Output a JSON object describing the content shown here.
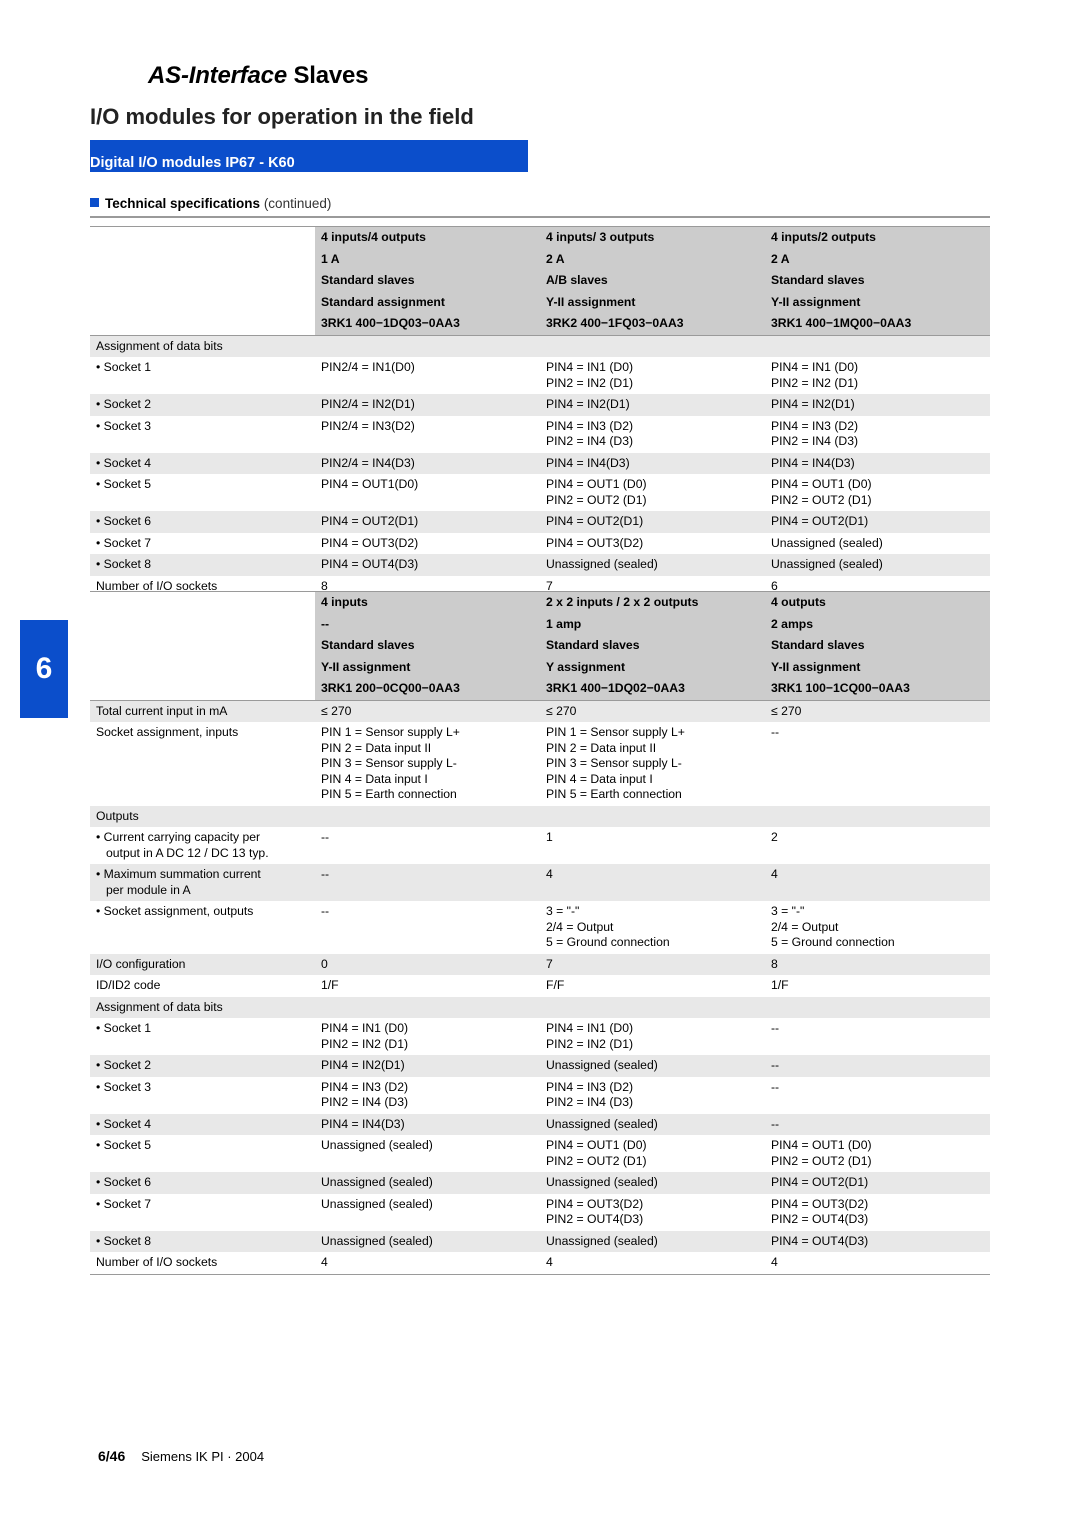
{
  "header": {
    "title_part1": "AS-Interface",
    "title_part2": " Slaves",
    "subtitle": "I/O modules for operation in the field",
    "blue_bar": "Digital I/O modules IP67 - K60",
    "section_title": "Technical specifications",
    "section_suffix": " (continued)",
    "chapter_number": "6",
    "accent_color": "#0b4ecb"
  },
  "footer": {
    "page": "6/46",
    "source": "Siemens IK PI · 2004"
  },
  "table1": {
    "header_rows": [
      [
        "",
        "4 inputs/4 outputs",
        "4 inputs/ 3 outputs",
        "4 inputs/2 outputs"
      ],
      [
        "",
        "1 A",
        "2 A",
        "2 A"
      ],
      [
        "",
        "Standard slaves",
        "A/B slaves",
        "Standard slaves"
      ],
      [
        "",
        "Standard assignment",
        "Y-II assignment",
        "Y-II assignment"
      ],
      [
        "",
        "3RK1 400−1DQ03−0AA3",
        "3RK2 400−1FQ03−0AA3",
        "3RK1 400−1MQ00−0AA3"
      ]
    ],
    "rows": [
      {
        "label": "Assignment of data bits",
        "bullet": false,
        "cells": [
          "",
          "",
          ""
        ]
      },
      {
        "label": "Socket 1",
        "bullet": true,
        "cells": [
          "PIN2/4 = IN1(D0)",
          "PIN4 = IN1 (D0)\nPIN2 = IN2 (D1)",
          "PIN4 = IN1 (D0)\nPIN2 = IN2 (D1)"
        ]
      },
      {
        "label": "Socket 2",
        "bullet": true,
        "cells": [
          "PIN2/4 = IN2(D1)",
          "PIN4 = IN2(D1)",
          "PIN4 = IN2(D1)"
        ]
      },
      {
        "label": "Socket 3",
        "bullet": true,
        "cells": [
          "PIN2/4 = IN3(D2)",
          "PIN4 = IN3 (D2)\nPIN2 = IN4 (D3)",
          "PIN4 = IN3 (D2)\nPIN2 = IN4 (D3)"
        ]
      },
      {
        "label": "Socket 4",
        "bullet": true,
        "cells": [
          "PIN2/4 = IN4(D3)",
          "PIN4 = IN4(D3)",
          "PIN4 = IN4(D3)"
        ]
      },
      {
        "label": "Socket 5",
        "bullet": true,
        "cells": [
          "PIN4 = OUT1(D0)",
          "PIN4 = OUT1 (D0)\nPIN2 = OUT2 (D1)",
          "PIN4 = OUT1 (D0)\nPIN2 = OUT2 (D1)"
        ]
      },
      {
        "label": "Socket 6",
        "bullet": true,
        "cells": [
          "PIN4 = OUT2(D1)",
          "PIN4 = OUT2(D1)",
          "PIN4 = OUT2(D1)"
        ]
      },
      {
        "label": "Socket 7",
        "bullet": true,
        "cells": [
          "PIN4 = OUT3(D2)",
          "PIN4 = OUT3(D2)",
          "Unassigned (sealed)"
        ]
      },
      {
        "label": "Socket 8",
        "bullet": true,
        "cells": [
          "PIN4 = OUT4(D3)",
          "Unassigned (sealed)",
          "Unassigned (sealed)"
        ]
      },
      {
        "label": "Number of I/O sockets",
        "bullet": false,
        "cells": [
          "8",
          "7",
          "6"
        ]
      }
    ]
  },
  "table2": {
    "header_rows": [
      [
        "",
        "4 inputs",
        "2 x 2 inputs / 2 x 2 outputs",
        "4 outputs"
      ],
      [
        "",
        "--",
        "1 amp",
        "2 amps"
      ],
      [
        "",
        "Standard slaves",
        "Standard slaves",
        "Standard slaves"
      ],
      [
        "",
        "Y-II assignment",
        "Y assignment",
        "Y-II assignment"
      ],
      [
        "",
        "3RK1 200−0CQ00−0AA3",
        "3RK1 400−1DQ02−0AA3",
        "3RK1 100−1CQ00−0AA3"
      ]
    ],
    "rows": [
      {
        "label": "Total current input in mA",
        "bullet": false,
        "cells": [
          "≤ 270",
          "≤ 270",
          "≤ 270"
        ]
      },
      {
        "label": "Socket assignment, inputs",
        "bullet": false,
        "cells": [
          "PIN 1 = Sensor supply L+\nPIN 2 = Data input II\nPIN 3 = Sensor supply L-\nPIN 4 = Data input I\nPIN 5 = Earth connection",
          "PIN 1 = Sensor supply L+\nPIN 2 = Data input II\nPIN 3 = Sensor supply L-\nPIN 4 = Data input I\nPIN 5 = Earth connection",
          "--"
        ]
      },
      {
        "label": "Outputs",
        "bullet": false,
        "cells": [
          "",
          "",
          ""
        ]
      },
      {
        "label": "Current carrying capacity per\noutput in A DC 12 / DC 13 typ.",
        "bullet": true,
        "cells": [
          "--",
          "1",
          "2"
        ]
      },
      {
        "label": "Maximum summation current\nper module in A",
        "bullet": true,
        "cells": [
          "--",
          "4",
          "4"
        ]
      },
      {
        "label": "Socket assignment, outputs",
        "bullet": true,
        "cells": [
          "--",
          "3 = \"-\"\n2/4 = Output\n5 = Ground connection",
          "3 = \"-\"\n2/4 = Output\n5 = Ground connection"
        ]
      },
      {
        "label": "I/O configuration",
        "bullet": false,
        "cells": [
          "0",
          "7",
          "8"
        ]
      },
      {
        "label": "ID/ID2 code",
        "bullet": false,
        "cells": [
          "1/F",
          "F/F",
          "1/F"
        ]
      },
      {
        "label": "Assignment of data bits",
        "bullet": false,
        "cells": [
          "",
          "",
          ""
        ]
      },
      {
        "label": "Socket 1",
        "bullet": true,
        "cells": [
          "PIN4 = IN1 (D0)\nPIN2 = IN2 (D1)",
          "PIN4 = IN1 (D0)\nPIN2 = IN2 (D1)",
          "--"
        ]
      },
      {
        "label": "Socket 2",
        "bullet": true,
        "cells": [
          "PIN4 = IN2(D1)",
          "Unassigned (sealed)",
          "--"
        ]
      },
      {
        "label": "Socket 3",
        "bullet": true,
        "cells": [
          "PIN4 = IN3 (D2)\nPIN2 = IN4 (D3)",
          "PIN4 = IN3 (D2)\nPIN2 = IN4 (D3)",
          "--"
        ]
      },
      {
        "label": "Socket 4",
        "bullet": true,
        "cells": [
          "PIN4 = IN4(D3)",
          "Unassigned (sealed)",
          "--"
        ]
      },
      {
        "label": "Socket 5",
        "bullet": true,
        "cells": [
          "Unassigned (sealed)",
          "PIN4 = OUT1 (D0)\nPIN2 = OUT2 (D1)",
          "PIN4 = OUT1 (D0)\nPIN2 = OUT2 (D1)"
        ]
      },
      {
        "label": "Socket 6",
        "bullet": true,
        "cells": [
          "Unassigned (sealed)",
          "Unassigned (sealed)",
          "PIN4 = OUT2(D1)"
        ]
      },
      {
        "label": "Socket 7",
        "bullet": true,
        "cells": [
          "Unassigned (sealed)",
          "PIN4 = OUT3(D2)\nPIN2 = OUT4(D3)",
          "PIN4 = OUT3(D2)\nPIN2 = OUT4(D3)"
        ]
      },
      {
        "label": "Socket 8",
        "bullet": true,
        "cells": [
          "Unassigned (sealed)",
          "Unassigned (sealed)",
          "PIN4 = OUT4(D3)"
        ]
      },
      {
        "label": "Number of I/O sockets",
        "bullet": false,
        "cells": [
          "4",
          "4",
          "4"
        ]
      }
    ]
  }
}
